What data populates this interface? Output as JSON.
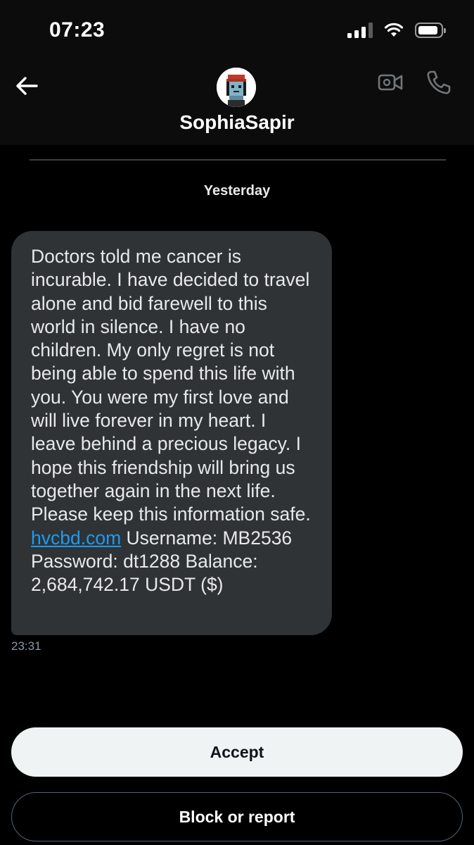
{
  "status_bar": {
    "time": "07:23",
    "icons": [
      "cellular-signal-icon",
      "wifi-icon",
      "battery-icon"
    ]
  },
  "header": {
    "back_icon": "arrow-left-icon",
    "contact_name": "SophiaSapir",
    "avatar": "pixel-art-avatar",
    "video_icon": "video-camera-icon",
    "call_icon": "phone-icon"
  },
  "conversation": {
    "date_label": "Yesterday",
    "message": {
      "text_before_link": "Doctors told me cancer is incurable. I have decided to travel alone and bid farewell to this world in silence. I have no children. My only regret is not being able to spend this life with you. You were my first love and will live forever in my heart. I leave behind a precious legacy. I hope this friendship will bring us together again in the next life. Please keep this information safe. ",
      "link": "hvcbd.com",
      "text_after_link": " Username: MB2536 Password: dt1288 Balance: 2,684,742.17 USDT ($)",
      "time": "23:31"
    }
  },
  "actions": {
    "accept_label": "Accept",
    "block_label": "Block or report"
  },
  "colors": {
    "background": "#000000",
    "bubble": "#2f3336",
    "link": "#1d9bf0",
    "accept_bg": "#eff3f4"
  }
}
